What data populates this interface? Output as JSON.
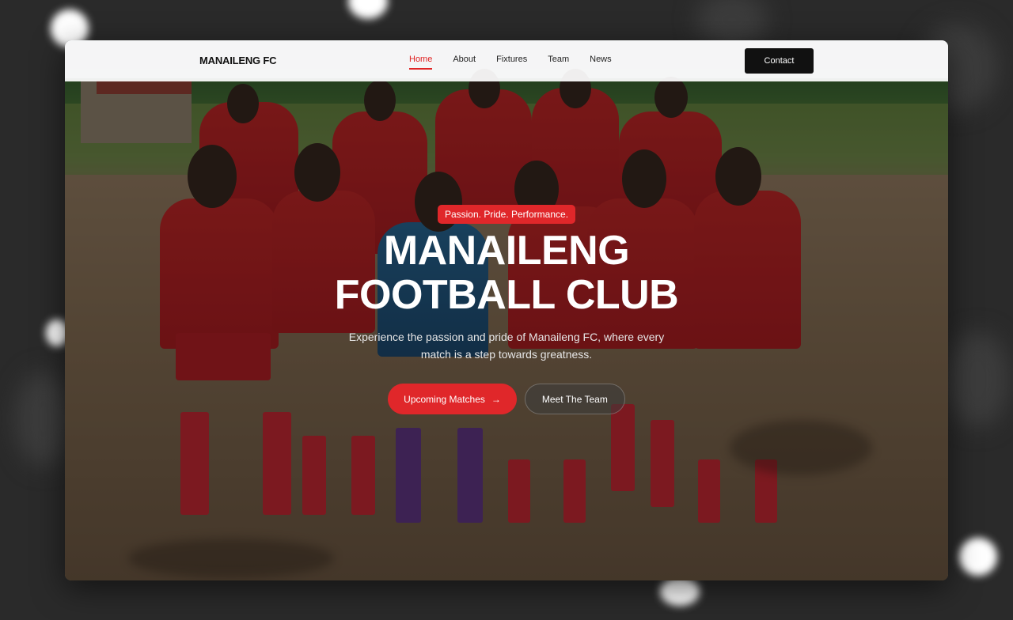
{
  "nav": {
    "brand": "MANAILENG FC",
    "links": [
      {
        "label": "Home",
        "active": true
      },
      {
        "label": "About"
      },
      {
        "label": "Fixtures"
      },
      {
        "label": "Team"
      },
      {
        "label": "News"
      }
    ],
    "contact_label": "Contact"
  },
  "hero": {
    "tagline": "Passion. Pride. Performance.",
    "title_line1": "MANAILENG",
    "title_line2": "FOOTBALL CLUB",
    "subtitle": "Experience the passion and pride of Manaileng FC, where every match is a step towards greatness.",
    "primary_cta": "Upcoming Matches",
    "primary_cta_icon": "arrow-right-icon",
    "secondary_cta": "Meet The Team"
  },
  "colors": {
    "accent": "#e0272a",
    "nav_bg": "#ffffff",
    "contact_bg": "#111111",
    "page_bg": "#2a2a2a"
  }
}
